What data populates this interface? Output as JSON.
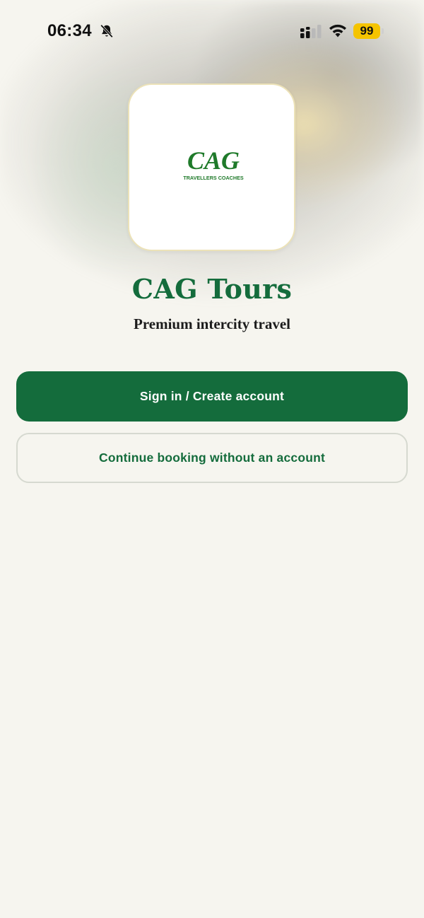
{
  "status_bar": {
    "time": "06:34",
    "battery_level": "99",
    "icons": [
      "bell-off-icon",
      "cellular-signal-icon",
      "wifi-icon",
      "battery-icon"
    ]
  },
  "logo": {
    "brand_mark": "CAG",
    "brand_sub": "TRAVELLERS COACHES"
  },
  "header": {
    "title": "CAG Tours",
    "tagline": "Premium intercity travel"
  },
  "actions": {
    "primary_label": "Sign in / Create account",
    "secondary_label": "Continue booking without an account"
  },
  "colors": {
    "brand_green": "#146c3c",
    "background": "#f6f5ef",
    "battery_yellow": "#f5c400"
  }
}
